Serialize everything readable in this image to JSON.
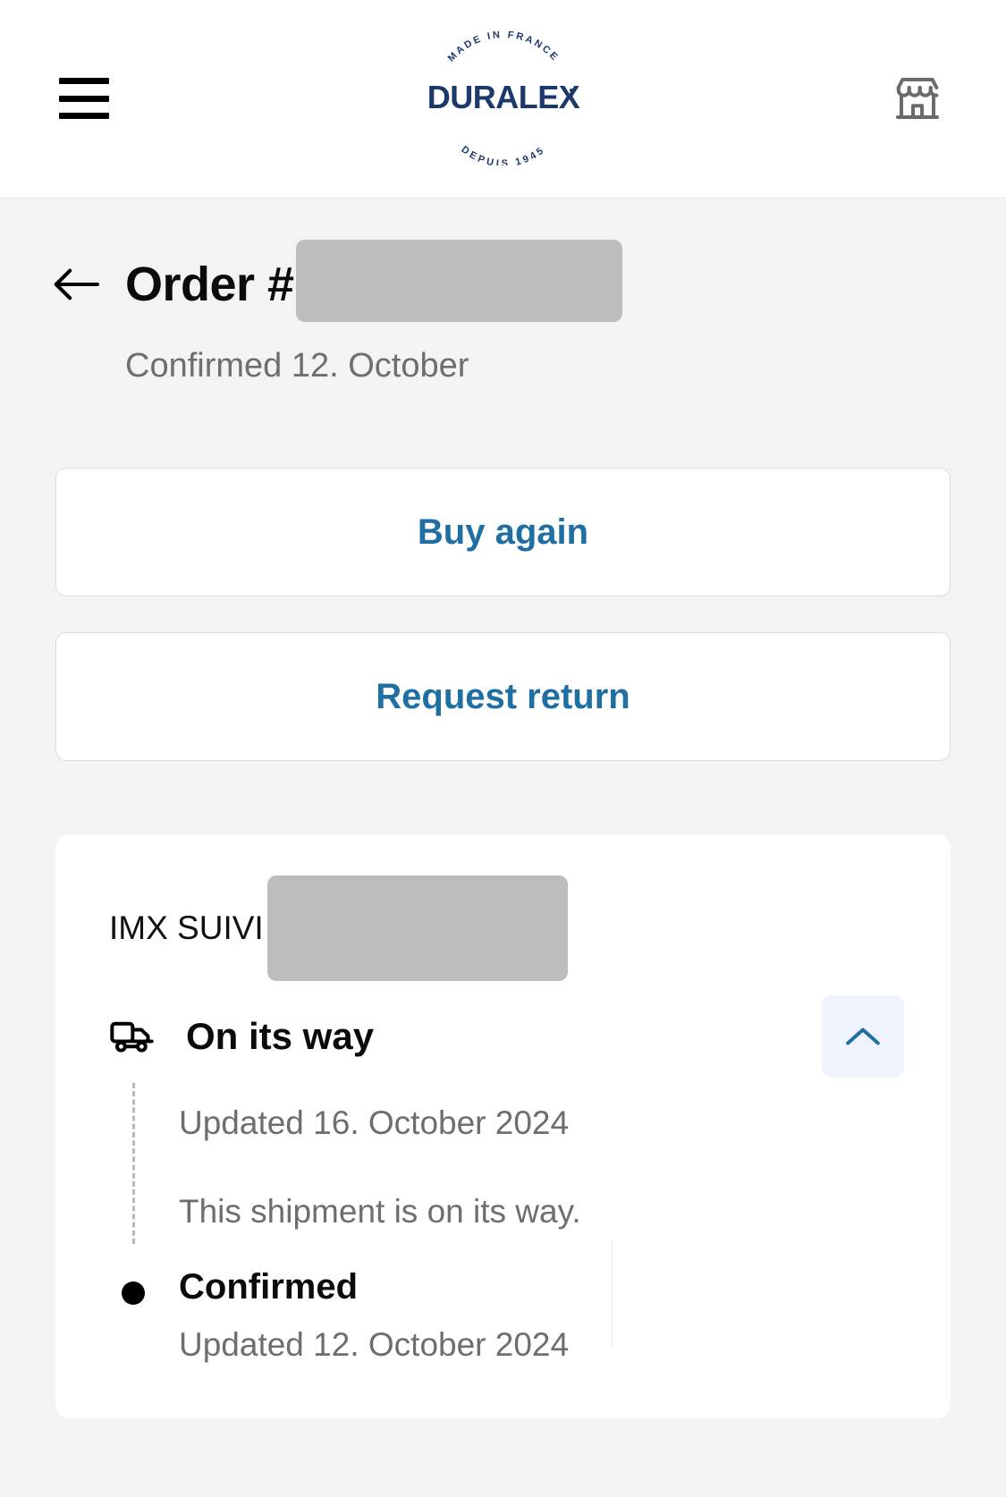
{
  "header": {
    "menu_icon": "hamburger-menu-icon",
    "store_icon": "storefront-icon",
    "brand": {
      "name": "DURALEX",
      "top_arc": "MADE IN FRANCE",
      "bottom_arc": "DEPUIS 1945",
      "color": "#1b3a6b"
    }
  },
  "order": {
    "back_icon": "back-arrow-icon",
    "title_prefix": "Order #",
    "order_number_redacted": true,
    "status_line": "Confirmed 12. October"
  },
  "actions": {
    "buy_again": "Buy again",
    "request_return": "Request return",
    "link_color": "#1f6fa3"
  },
  "tracking": {
    "carrier_label": "IMX SUIVI",
    "tracking_number_redacted": true,
    "status_icon": "delivery-truck-icon",
    "status_title": "On its way",
    "collapse_icon": "chevron-up-icon",
    "collapse_bg": "#eef3fd",
    "events": [
      {
        "updated": "Updated 16. October 2024",
        "description": "This shipment is on its way."
      }
    ],
    "final_event": {
      "title": "Confirmed",
      "updated": "Updated 12. October 2024"
    }
  }
}
